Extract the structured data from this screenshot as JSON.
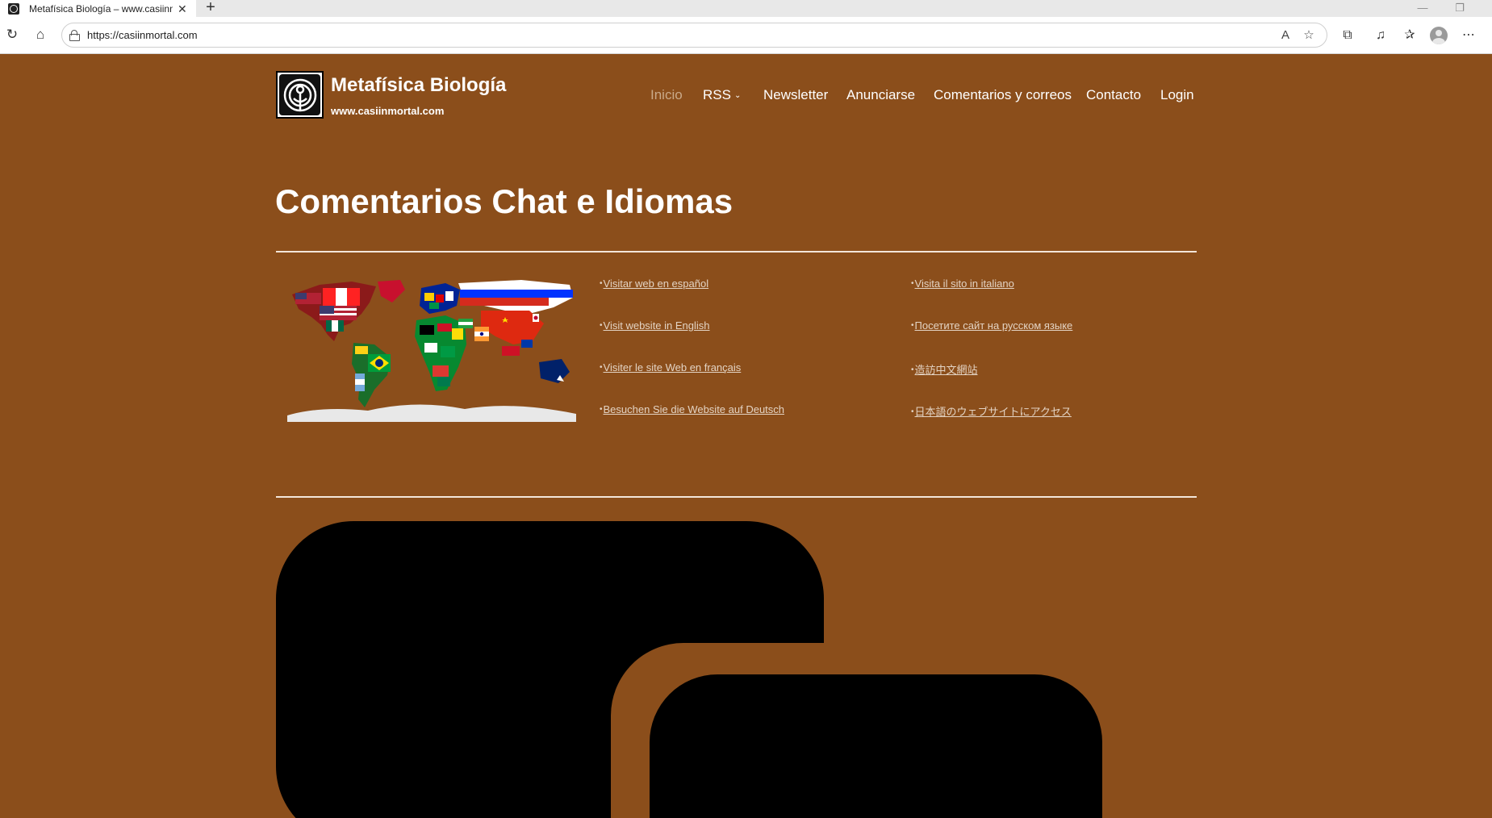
{
  "browser": {
    "tab_title": "Metafísica Biología – www.casiinmortal.com",
    "tab_close": "✕",
    "new_tab": "+",
    "url": "https://casiinmortal.com",
    "window_controls": {
      "minimize": "—",
      "restore": "❐"
    },
    "icons": [
      "refresh-icon",
      "home-icon",
      "lock-icon",
      "read-aloud-icon",
      "favorite-star-icon",
      "extensions-icon",
      "media-icon",
      "favorites-icon",
      "profile-icon",
      "more-icon"
    ]
  },
  "site": {
    "title": "Metafísica Biología",
    "tagline": "www.casiinmortal.com"
  },
  "nav": {
    "items": [
      {
        "label": "Inicio",
        "current": true
      },
      {
        "label": "RSS",
        "has_submenu": true,
        "chevron": "⌄"
      },
      {
        "label": "Newsletter"
      },
      {
        "label": "Anunciarse"
      },
      {
        "label": "Comentarios y correos"
      },
      {
        "label": "Contacto"
      },
      {
        "label": "Login"
      }
    ]
  },
  "main": {
    "page_title": "Comentarios Chat e Idiomas",
    "bullet": "•",
    "languages": [
      {
        "text": "Visitar web en español"
      },
      {
        "text": "Visit website in English"
      },
      {
        "text": "Visiter le site Web en français"
      },
      {
        "text": "Besuchen Sie die Website auf Deutsch"
      },
      {
        "text": "Visita il sito in italiano"
      },
      {
        "text": "Посетите сайт на русском языке"
      },
      {
        "text": "造訪中文網站"
      },
      {
        "text": "日本語のウェブサイトにアクセス"
      }
    ]
  },
  "colors": {
    "page_background": "#8b4e1b",
    "link": "#e3d3c3",
    "nav_current": "#c9a989",
    "divider": "#f3e6da"
  }
}
